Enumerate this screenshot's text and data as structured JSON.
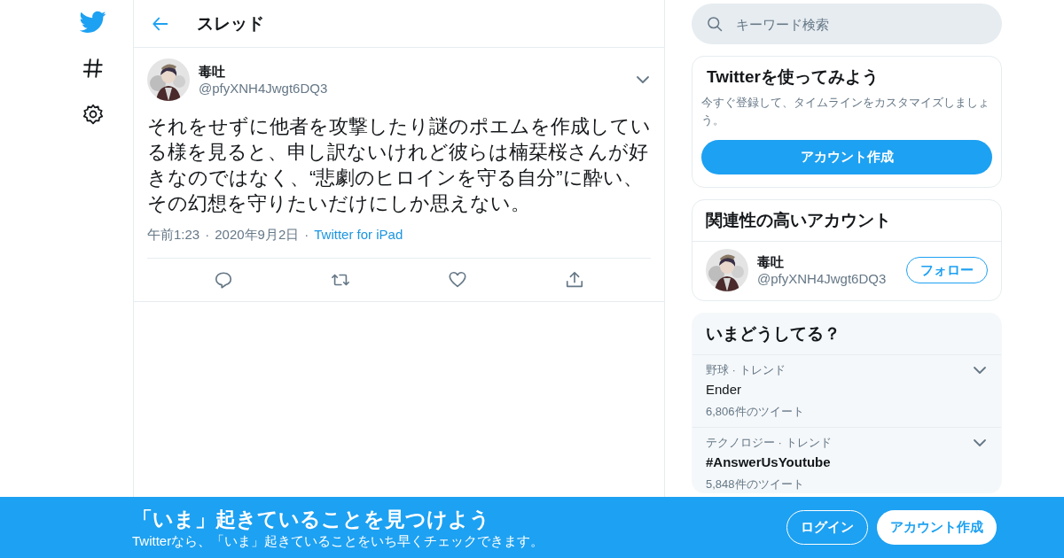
{
  "header": {
    "title": "スレッド"
  },
  "tweet": {
    "author": {
      "name": "毒吐",
      "handle": "@pfyXNH4Jwgt6DQ3"
    },
    "text": "それをせずに他者を攻撃したり謎のポエムを作成している様を見ると、申し訳ないけれど彼らは楠栞桜さんが好きなのではなく、“悲劇のヒロインを守る自分”に酔い、その幻想を守りたいだけにしか思えない。",
    "time": "午前1:23",
    "date": "2020年9月2日",
    "separator": "·",
    "source": "Twitter for iPad"
  },
  "search": {
    "placeholder": "キーワード検索"
  },
  "signup_card": {
    "title": "Twitterを使ってみよう",
    "description": "今すぐ登録して、タイムラインをカスタマイズしましょう。",
    "button": "アカウント作成"
  },
  "related": {
    "title": "関連性の高いアカウント",
    "accounts": [
      {
        "name": "毒吐",
        "handle": "@pfyXNH4Jwgt6DQ3",
        "button": "フォロー"
      }
    ]
  },
  "trends": {
    "title": "いまどうしてる？",
    "items": [
      {
        "context": "野球 · トレンド",
        "name": "Ender",
        "count": "6,806件のツイート"
      },
      {
        "context": "テクノロジー · トレンド",
        "name": "#AnswerUsYoutube",
        "count": "5,848件のツイート"
      }
    ]
  },
  "banner": {
    "title": "「いま」起きていることを見つけよう",
    "subtitle": "Twitterなら、「いま」起きていることをいち早くチェックできます。",
    "buttons": [
      {
        "label": "ログイン",
        "kind": "outline"
      },
      {
        "label": "アカウント作成",
        "kind": "filled"
      }
    ]
  }
}
